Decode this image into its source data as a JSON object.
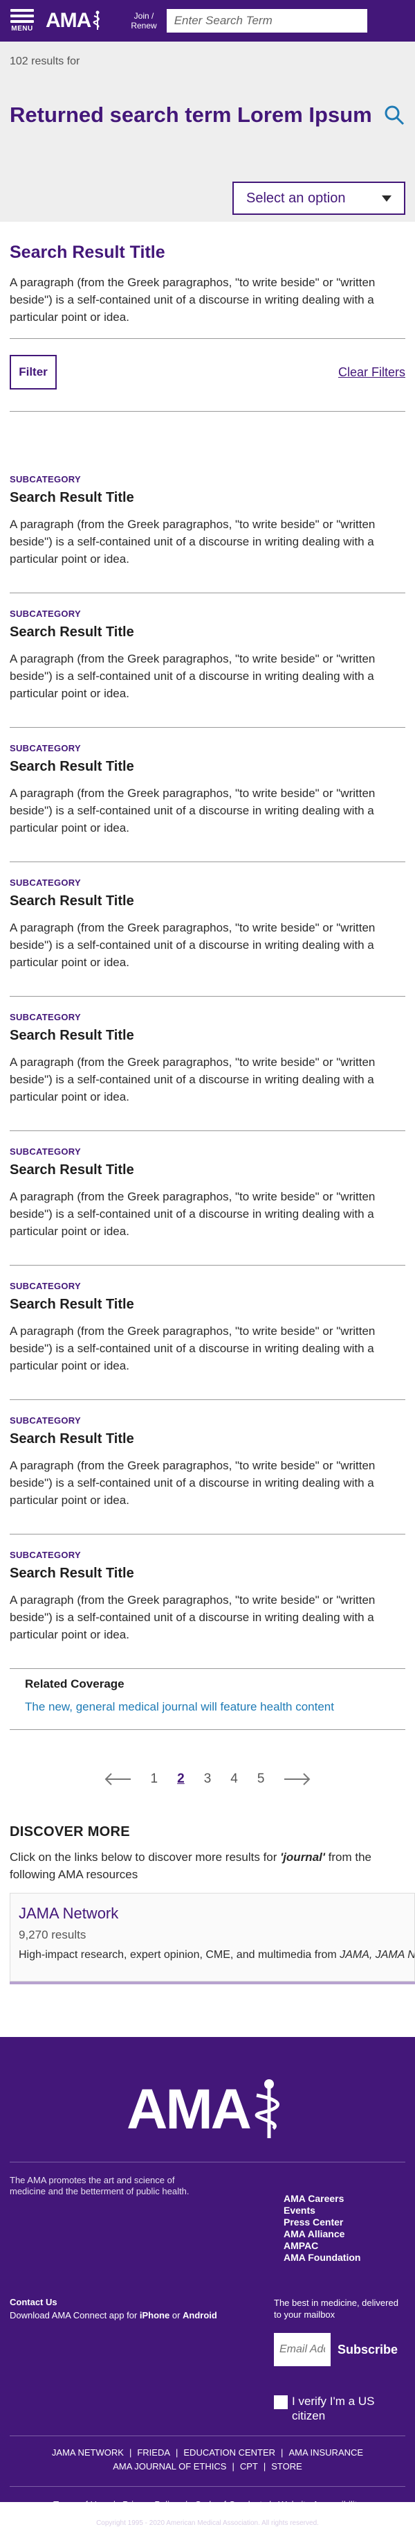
{
  "header": {
    "menu_label": "MENU",
    "logo_text": "AMA",
    "join_line1": "Join /",
    "join_line2": "Renew",
    "search_placeholder": "Enter Search Term"
  },
  "results": {
    "count_text": "102 results for",
    "search_term": "Returned search term Lorem Ipsum",
    "sort_label": "Select an option"
  },
  "featured": {
    "title": "Search Result Title",
    "description": "A paragraph (from the Greek paragraphos, \"to write beside\" or \"written beside\") is a self-contained unit of a discourse in writing dealing with a particular point or idea."
  },
  "filters": {
    "filter_label": "Filter",
    "clear_label": "Clear Filters"
  },
  "result_items": [
    {
      "subcategory": "SUBCATEGORY",
      "title": "Search Result Title",
      "description": "A paragraph (from the Greek paragraphos, \"to write beside\" or \"written beside\") is a self-contained unit of a discourse in writing dealing with a particular point or idea."
    },
    {
      "subcategory": "SUBCATEGORY",
      "title": "Search Result Title",
      "description": "A paragraph (from the Greek paragraphos, \"to write beside\" or \"written beside\") is a self-contained unit of a discourse in writing dealing with a particular point or idea."
    },
    {
      "subcategory": "SUBCATEGORY",
      "title": "Search Result Title",
      "description": "A paragraph (from the Greek paragraphos, \"to write beside\" or \"written beside\") is a self-contained unit of a discourse in writing dealing with a particular point or idea."
    },
    {
      "subcategory": "SUBCATEGORY",
      "title": "Search Result Title",
      "description": "A paragraph (from the Greek paragraphos, \"to write beside\" or \"written beside\") is a self-contained unit of a discourse in writing dealing with a particular point or idea."
    },
    {
      "subcategory": "SUBCATEGORY",
      "title": "Search Result Title",
      "description": "A paragraph (from the Greek paragraphos, \"to write beside\" or \"written beside\") is a self-contained unit of a discourse in writing dealing with a particular point or idea."
    },
    {
      "subcategory": "SUBCATEGORY",
      "title": "Search Result Title",
      "description": "A paragraph (from the Greek paragraphos, \"to write beside\" or \"written beside\") is a self-contained unit of a discourse in writing dealing with a particular point or idea."
    },
    {
      "subcategory": "SUBCATEGORY",
      "title": "Search Result Title",
      "description": "A paragraph (from the Greek paragraphos, \"to write beside\" or \"written beside\") is a self-contained unit of a discourse in writing dealing with a particular point or idea."
    },
    {
      "subcategory": "SUBCATEGORY",
      "title": "Search Result Title",
      "description": "A paragraph (from the Greek paragraphos, \"to write beside\" or \"written beside\") is a self-contained unit of a discourse in writing dealing with a particular point or idea."
    },
    {
      "subcategory": "SUBCATEGORY",
      "title": "Search Result Title",
      "description": "A paragraph (from the Greek paragraphos, \"to write beside\" or \"written beside\") is a self-contained unit of a discourse in writing dealing with a particular point or idea."
    }
  ],
  "related": {
    "heading": "Related Coverage",
    "link_text": "The new, general medical journal will feature health content"
  },
  "pagination": {
    "pages": [
      "1",
      "2",
      "3",
      "4",
      "5"
    ],
    "active_page": "2",
    "prev_icon": "arrow-left-icon",
    "next_icon": "arrow-right-icon"
  },
  "discover": {
    "heading": "DISCOVER MORE",
    "desc_before": "Click on the links below to discover more results for ",
    "query": "'journal'",
    "desc_after": " from the following AMA resources",
    "card": {
      "title": "JAMA Network",
      "count": "9,270 results",
      "desc_before": "High-impact research, expert opinion, CME, and multimedia from ",
      "desc_italic": "JAMA, JAMA Network Open"
    }
  },
  "footer": {
    "logo_text": "AMA",
    "tagline": "The AMA promotes the art and science of medicine and the betterment of public health.",
    "links": [
      "AMA Careers",
      "Events",
      "Press Center",
      "AMA Alliance",
      "AMPAC",
      "AMA Foundation"
    ],
    "contact_title": "Contact Us",
    "contact_app_before": "Download AMA Connect app for ",
    "contact_app_iphone": "iPhone",
    "contact_app_or": " or ",
    "contact_app_android": "Android",
    "newsletter_text": "The best in medicine, delivered to your mailbox",
    "email_placeholder": "Email Address",
    "subscribe_label": "Subscribe",
    "verify_label": "I verify I'm a US citizen",
    "nav_row1": [
      "JAMA NETWORK",
      "FRIEDA",
      "EDUCATION CENTER",
      "AMA INSURANCE"
    ],
    "nav_row2": [
      "AMA JOURNAL OF ETHICS",
      "CPT",
      "STORE"
    ],
    "legal": [
      "Terms of Use",
      "Privacy Policy",
      "Code of Conduct",
      "Website Accessibility"
    ],
    "copyright": "Copyright 1995 - 2020 American Medical Association. All rights reserved."
  },
  "colors": {
    "brand_purple": "#431779",
    "link_blue": "#1f7bb5",
    "band_gray": "#eeeeee"
  }
}
